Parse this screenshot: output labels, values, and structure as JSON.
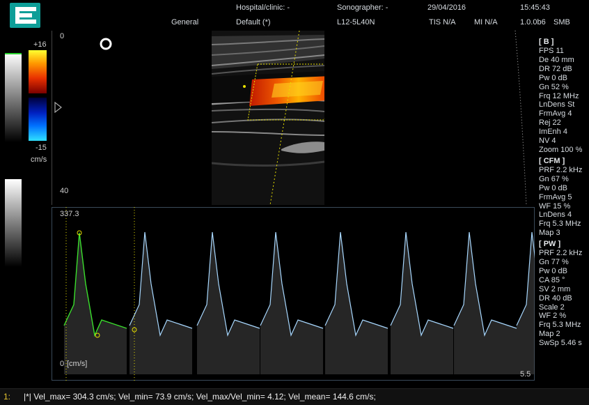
{
  "header": {
    "hospital": "Hospital/clinic: -",
    "sonographer": "Sonographer: -",
    "date": "29/04/2016",
    "time": "15:45:43",
    "preset_group": "General",
    "preset": "Default (*)",
    "probe": "L12-5L40N",
    "tis": "TIS N/A",
    "mi": "MI N/A",
    "version": "1.0.0b6",
    "mode": "SMB"
  },
  "color_scale": {
    "top": "+16",
    "bottom": "-15",
    "unit": "cm/s"
  },
  "bmode": {
    "depth_top": "0",
    "depth_bottom": "40"
  },
  "doppler": {
    "velocity_top": "337.3",
    "baseline": "0",
    "unit": "[cm/s]",
    "time_label": "5.5"
  },
  "params": {
    "b_head": "[ B ]",
    "b": [
      "FPS 11",
      "De 40 mm",
      "DR 72 dB",
      "Pw 0 dB",
      "Gn 52 %",
      "Frq 12 MHz",
      "LnDens St",
      "FrmAvg 4",
      "Rej 22",
      "ImEnh 4",
      "NV 4",
      "Zoom 100 %"
    ],
    "cfm_head": "[ CFM ]",
    "cfm": [
      "PRF 2.2 kHz",
      "Gn 67 %",
      "Pw 0 dB",
      "FrmAvg 5",
      "WF 15 %",
      "LnDens 4",
      "Frq 5.3 MHz",
      "Map 3"
    ],
    "pw_head": "[ PW ]",
    "pw": [
      "PRF 2.2 kHz",
      "Gn 77 %",
      "Pw 0 dB",
      "CA 85 °",
      "SV 2 mm",
      "DR 40 dB",
      "Scale 2",
      "WF 2 %",
      "Frq 5.3 MHz",
      "Map 2",
      "SwSp 5.46 s"
    ]
  },
  "status": {
    "index": "1:",
    "measurement": "|*| Vel_max= 304.3 cm/s; Vel_min= 73.9 cm/s; Vel_max/Vel_min= 4.12; Vel_mean= 144.6 cm/s;"
  },
  "colors": {
    "accent_logo": "#0e9e98",
    "trace_green": "#3adf2c",
    "trace_blue": "#a8d8ff",
    "roi_yellow": "#e8e000"
  }
}
